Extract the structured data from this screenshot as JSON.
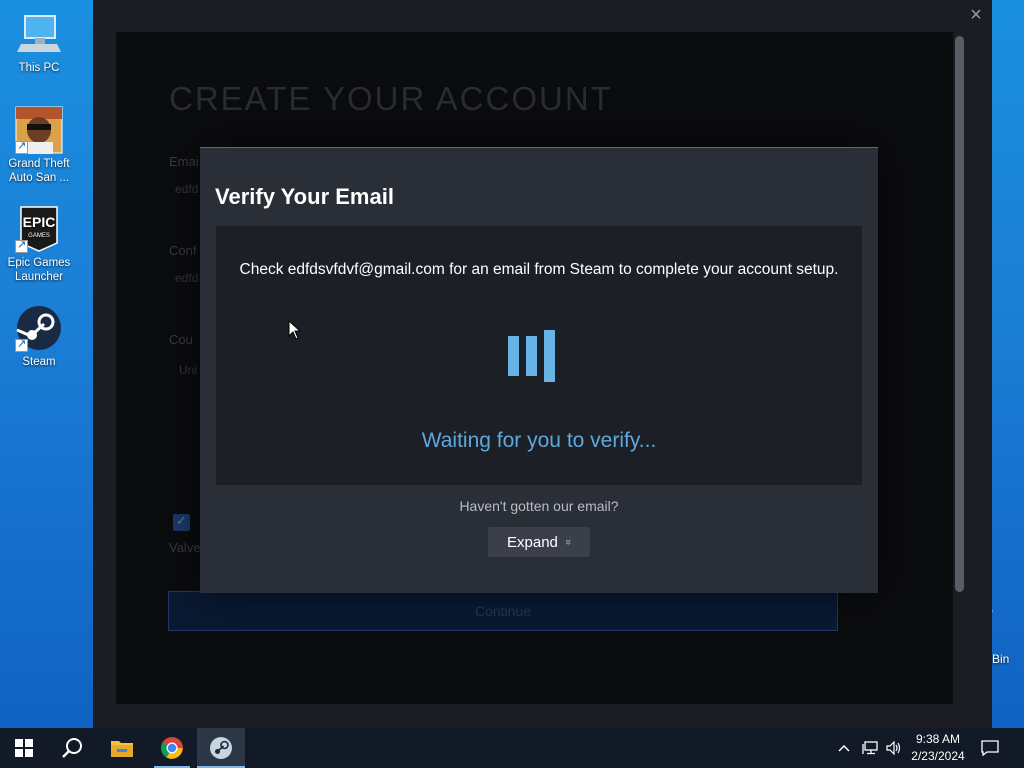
{
  "desktop": {
    "icons": [
      {
        "label": "This PC"
      },
      {
        "label": "Grand Theft Auto San ..."
      },
      {
        "label": "Epic Games Launcher"
      },
      {
        "label": "Steam"
      }
    ],
    "epic_logo_text": "EPIC",
    "epic_logo_sub": "GAMES",
    "recycle_bin_partial": "Bin"
  },
  "steam_window": {
    "close_glyph": "×",
    "background_form": {
      "title": "CREATE YOUR ACCOUNT",
      "email_label": "Emai",
      "email_value": "edfd",
      "confirm_label": "Conf",
      "confirm_value": "edfd",
      "country_label": "Cou",
      "country_value": "Uni",
      "valve_text": "Valve",
      "continue_label": "Continue"
    }
  },
  "modal": {
    "title": "Verify Your Email",
    "message": "Check edfdsvfdvf@gmail.com for an email from Steam to complete your account setup.",
    "waiting_text": "Waiting for you to verify...",
    "havent_text": "Haven't gotten our email?",
    "expand_label": "Expand",
    "expand_glyph": "»",
    "accent_color": "#5fa8dd"
  },
  "taskbar": {
    "time": "9:38 AM",
    "date": "2/23/2024",
    "tray_up_glyph": "^"
  }
}
